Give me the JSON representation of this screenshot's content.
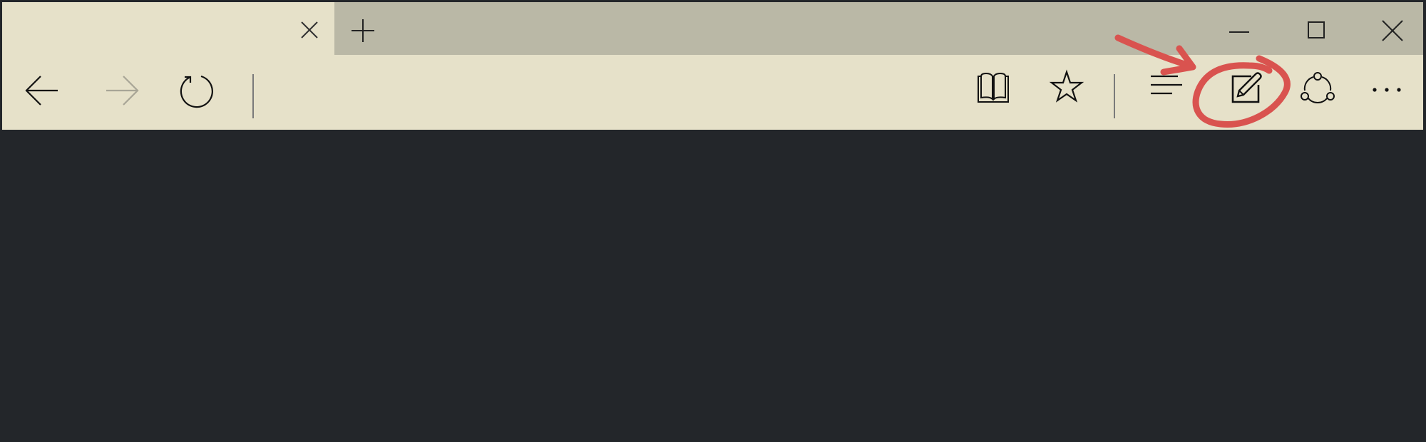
{
  "tab": {
    "title": "",
    "close_icon": "close-icon"
  },
  "titlebar": {
    "new_tab_icon": "plus-icon",
    "minimize_icon": "minimize-icon",
    "maximize_icon": "maximize-icon",
    "close_window_icon": "close-icon"
  },
  "toolbar": {
    "back_icon": "arrow-left-icon",
    "forward_icon": "arrow-right-icon",
    "forward_enabled": false,
    "refresh_icon": "refresh-icon",
    "reading_view_icon": "book-icon",
    "favorites_icon": "star-icon",
    "hub_icon": "hub-icon",
    "web_note_icon": "pen-note-icon",
    "share_icon": "share-icon",
    "more_icon": "ellipsis-icon"
  },
  "annotation": {
    "color": "#d9534f",
    "target": "web-note-button"
  },
  "colors": {
    "toolbar_bg": "#e6e1c9",
    "tab_strip_bg": "#bab8a6",
    "content_bg": "#23262a",
    "icon": "#111111",
    "icon_disabled": "#a8a596"
  }
}
